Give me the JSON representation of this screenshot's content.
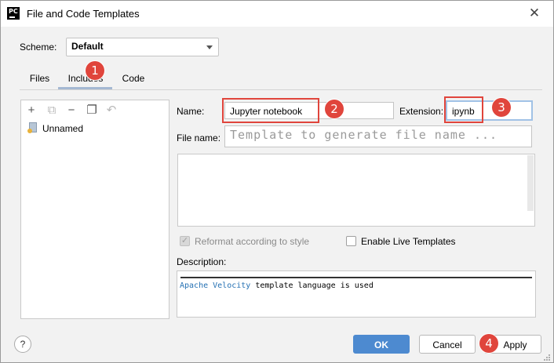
{
  "window": {
    "title": "File and Code Templates",
    "app_icon_label": "PC",
    "close_symbol": "✕"
  },
  "scheme": {
    "label": "Scheme:",
    "value": "Default"
  },
  "tabs": [
    {
      "label": "Files",
      "selected": false
    },
    {
      "label": "Includes",
      "selected": true
    },
    {
      "label": "Code",
      "selected": false
    }
  ],
  "toolbar": {
    "icons": [
      "add-icon",
      "copy-template-icon",
      "remove-icon",
      "duplicate-icon",
      "reset-icon"
    ],
    "add": "+",
    "create_child": "⧉",
    "remove": "−",
    "copy": "❐",
    "reset": "↶"
  },
  "templates_list": [
    {
      "label": "Unnamed",
      "icon": "template-file-icon"
    }
  ],
  "form": {
    "name_label": "Name:",
    "name_value": "Jupyter notebook",
    "extension_label": "Extension:",
    "extension_value": "ipynb",
    "file_name_label": "File name:",
    "file_name_placeholder": "Template to generate file name ...",
    "reformat_label": "Reformat according to style",
    "reformat_checked": true,
    "reformat_enabled": false,
    "live_templates_label": "Enable Live Templates",
    "live_templates_checked": false,
    "description_label": "Description:",
    "description_link": "Apache Velocity",
    "description_rest": " template language is used"
  },
  "footer": {
    "help": "?",
    "ok": "OK",
    "cancel": "Cancel",
    "apply": "Apply"
  },
  "annotations": [
    "1",
    "2",
    "3",
    "4"
  ],
  "colors": {
    "annotation": "#e0453c",
    "primary_button": "#4d8ad0",
    "link": "#2470b3",
    "focus": "#a1c2e6"
  }
}
